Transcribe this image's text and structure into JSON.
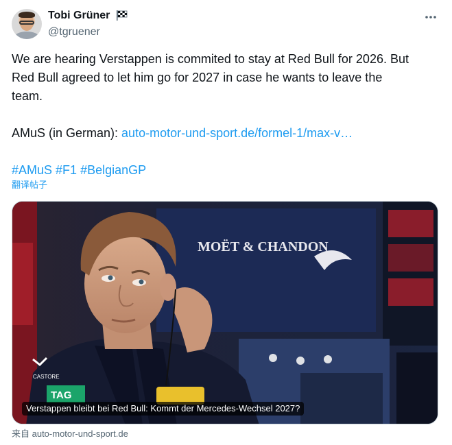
{
  "author": {
    "display_name": "Tobi Grüner",
    "handle": "@tgruener"
  },
  "icons": {
    "badge": "checkered-flag-icon",
    "menu": "more-dots-icon"
  },
  "tweet": {
    "line1": "We are hearing Verstappen is commited to stay at Red Bull for 2026. But",
    "line2": "Red Bull agreed to let him go for 2027 in case he wants to leave the",
    "line3": "team.",
    "source_prefix": "AMuS (in German): ",
    "source_link": "auto-motor-und-sport.de/formel-1/max-v…",
    "hashtags": [
      "#AMuS",
      "#F1",
      "#BelgianGP"
    ]
  },
  "translate_label": "翻译帖子",
  "card": {
    "caption": "Verstappen bleibt bei Red Bull: Kommt der Mercedes-Wechsel 2027?",
    "backdrop_text": "MOËT & CHANDON",
    "jacket_text": "TAG",
    "sponsor_text": "CASTORE"
  },
  "card_source": "来自 auto-motor-und-sport.de",
  "colors": {
    "link": "#1d9bf0",
    "secondary_text": "#536471",
    "primary_text": "#0f1419"
  }
}
